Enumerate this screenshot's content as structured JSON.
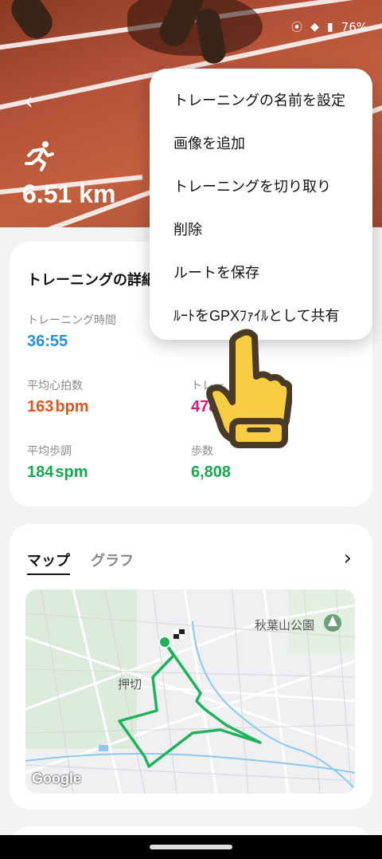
{
  "status_bar": {
    "battery": "76%"
  },
  "hero": {
    "back_label": "‹",
    "distance": "6.51 km"
  },
  "details": {
    "title": "トレーニングの詳細",
    "metrics": [
      {
        "label": "トレーニング時間",
        "value": "36:55",
        "color": "#2a8fd6"
      },
      {
        "label": "平均心拍数",
        "value": "163",
        "unit": "bpm",
        "color": "#e2541c"
      },
      {
        "label": "トレー",
        "value": "478",
        "color": "#e0197a"
      },
      {
        "label": "平均歩調",
        "value": "184",
        "unit": "spm",
        "color": "#17a84f"
      },
      {
        "label": "歩数",
        "value": "6,808",
        "color": "#17a84f"
      }
    ]
  },
  "map_section": {
    "tabs": [
      "マップ",
      "グラフ"
    ],
    "active_tab": "マップ",
    "pois": [
      "秋葉山公園",
      "押切"
    ],
    "attribution": "Google",
    "route_color": "#1fb25a"
  },
  "menu": {
    "items": [
      "トレーニングの名前を設定",
      "画像を追加",
      "トレーニングを切り取り",
      "削除",
      "ルートを保存",
      "ﾙｰﾄをGPXﾌｧｲﾙとして共有"
    ]
  },
  "colors": {
    "accent_blue": "#2a8fd6",
    "accent_orange": "#e2541c",
    "accent_pink": "#e0197a",
    "accent_green": "#17a84f",
    "hand_yellow": "#f7cd46"
  }
}
